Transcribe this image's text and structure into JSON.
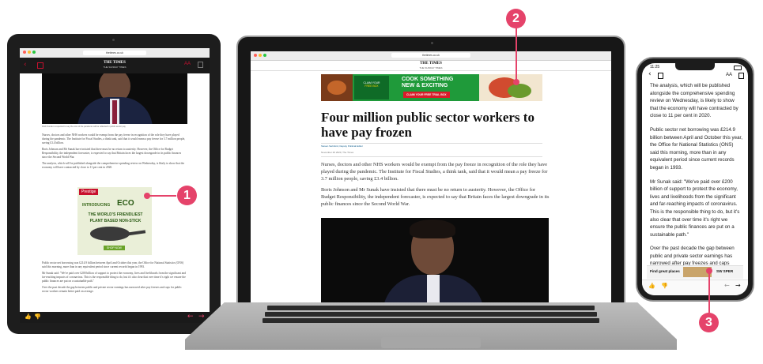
{
  "tablet": {
    "url": "thetimes.co.uk",
    "masthead": "THE TIMES",
    "masthead_sub": "THE SUNDAY TIMES",
    "photo_caption": "Rishi Sunak is expected to say the cost of the pandemic will be reflected in public sector pay",
    "paragraphs": [
      "Nurses, doctors and other NHS workers would be exempt from the pay freeze in recognition of the role they have played during the pandemic. The Institute for Fiscal Studies, a think tank, said that it would mean a pay freeze for 3.7 million people, saving £3.4 billion.",
      "Boris Johnson and Mr Sunak have insisted that there must be no return to austerity. However, the Office for Budget Responsibility, the independent forecaster, is expected to say that Britain faces the largest downgrade in its public finances since the Second World War.",
      "The analysis, which will be published alongside the comprehensive spending review on Wednesday, is likely to show that the economy will have contracted by close to 11 per cent in 2020."
    ],
    "paragraphs_after": [
      "Public sector net borrowing was £214.9 billion between April and October this year, the Office for National Statistics (ONS) said this morning, more than in any equivalent period since current records began in 1993.",
      "Mr Sunak said: \"We've paid over £200 billion of support to protect the economy, lives and livelihoods from the significant and far-reaching impacts of coronavirus. This is the responsible thing to do, but it's also clear that over time it's right we ensure the public finances are put on a sustainable path.\"",
      "Over the past decade the gap between public and private sector earnings has narrowed after pay freezes and caps for public sector workers remain better paid on average."
    ],
    "ad": {
      "brand": "Prestige",
      "line1": "INTRODUCING",
      "line2": "ECO",
      "line3": "THE WORLD'S FRIENDLIEST",
      "line4": "PLANT BASED NON-STICK",
      "cta": "SHOP NOW"
    }
  },
  "laptop": {
    "url": "thetimes.co.uk",
    "masthead": "THE TIMES",
    "masthead_sub": "THE SUNDAY TIMES",
    "ad": {
      "tag1": "CLAIM YOUR",
      "tag2": "FREE BOX",
      "headline1": "COOK SOMETHING",
      "headline2": "NEW & EXCITING",
      "cta": "CLAIM YOUR FREE TRIAL BOX"
    },
    "headline": "Four million public sector workers to have pay frozen",
    "byline": "Steven Swinford, Deputy Political Editor",
    "date": "November 20 2020, The Times",
    "paragraphs": [
      "Nurses, doctors and other NHS workers would be exempt from the pay freeze in recognition of the role they have played during the pandemic. The Institute for Fiscal Studies, a think tank, said that it would mean a pay freeze for 3.7 million people, saving £3.4 billion.",
      "Boris Johnson and Mr Sunak have insisted that there must be no return to austerity. However, the Office for Budget Responsibility, the independent forecaster, is expected to say that Britain faces the largest downgrade in its public finances since the Second World War."
    ]
  },
  "phone": {
    "time": "11:25",
    "paragraphs": [
      "The analysis, which will be published alongside the comprehensive spending review on Wednesday, is likely to show that the economy will have contracted by close to 11 per cent in 2020.",
      "Public sector net borrowing was £214.9 billion between April and October this year, the Office for National Statistics (ONS) said this morning, more than in any equivalent period since current records began in 1993.",
      "Mr Sunak said: \"We've paid over £200 billion of support to protect the economy, lives and livelihoods from the significant and far-reaching impacts of coronavirus. This is the responsible thing to do, but it's also clear that over time it's right we ensure the public finances are put on a sustainable path.\"",
      "Over the past decade the gap between public and private sector earnings has narrowed after pay freezes and caps"
    ],
    "ad": {
      "text": "Find great places",
      "brand": "SW SPER"
    }
  },
  "callouts": [
    "1",
    "2",
    "3"
  ],
  "colors": {
    "accent": "#e5436a",
    "times_red": "#c8102e",
    "ad_green": "#1f9a3a"
  }
}
